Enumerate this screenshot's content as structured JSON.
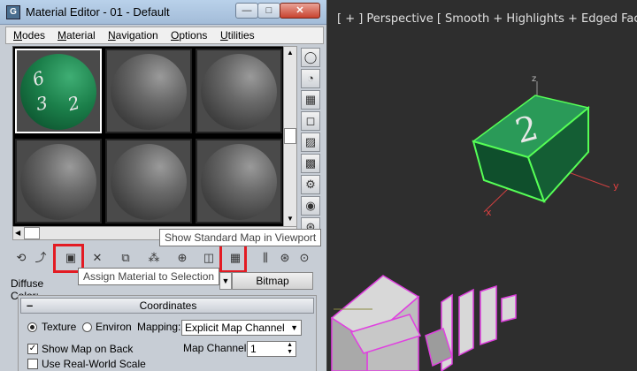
{
  "window": {
    "title": "Material Editor - 01 - Default",
    "app_icon": "G",
    "minimize": "—",
    "maximize": "□",
    "close": "✕"
  },
  "menu": {
    "items": [
      "Modes",
      "Material",
      "Navigation",
      "Options",
      "Utilities"
    ]
  },
  "slots": {
    "active_numbers": [
      "6",
      "3",
      "2"
    ]
  },
  "tooltips": {
    "show_map": "Show Standard Map in Viewport",
    "assign": "Assign Material to Selection"
  },
  "diffuse": {
    "label": "Diffuse Color:",
    "map_button": "Bitmap"
  },
  "coordinates": {
    "title": "Coordinates",
    "collapse": "–",
    "texture_label": "Texture",
    "environ_label": "Environ",
    "mapping_label": "Mapping:",
    "mapping_value": "Explicit Map Channel",
    "show_map_on_back": "Show Map on Back",
    "map_channel_label": "Map Channel:",
    "map_channel_value": "1",
    "use_real_world": "Use Real-World Scale"
  },
  "viewport": {
    "label": "[ + ]  Perspective  [ Smooth + Highlights + Edged Faces ]",
    "cube_face": "2",
    "axis_x": "x",
    "axis_y": "y",
    "axis_z": "z"
  },
  "colors": {
    "highlight": "#e31b23",
    "cube_green": "#1e8a4c",
    "selection_outline": "#56ff56",
    "scene_pink": "#e040e0"
  }
}
